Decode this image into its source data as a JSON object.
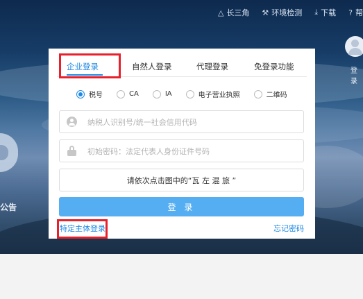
{
  "top_nav": [
    {
      "icon": "triangle-icon",
      "glyph": "△",
      "label": "长三角"
    },
    {
      "icon": "wrench-icon",
      "glyph": "⚒",
      "label": "环境检测"
    },
    {
      "icon": "download-icon",
      "glyph": "⤓",
      "label": "下载"
    },
    {
      "icon": "help-icon",
      "glyph": "?",
      "label": "帮"
    }
  ],
  "background": {
    "left_text": "公告",
    "right_text": "登录"
  },
  "tabs": [
    "企业登录",
    "自然人登录",
    "代理登录",
    "免登录功能"
  ],
  "active_tab": "企业登录",
  "radios": [
    "税号",
    "CA",
    "IA",
    "电子营业执照",
    "二维码"
  ],
  "selected_radio": "税号",
  "fields": {
    "taxid_placeholder": "纳税人识别号/统一社会信用代码",
    "password_placeholder": "初始密码：法定代表人身份证件号码"
  },
  "captcha_text": "请依次点击图中的“瓦 左 混 旅 ”",
  "login_button": "登 录",
  "links": {
    "special_login": "特定主体登录",
    "forgot_password": "忘记密码"
  },
  "colors": {
    "accent": "#1e88e5",
    "button": "#55aef1",
    "highlight": "#e8202b"
  }
}
